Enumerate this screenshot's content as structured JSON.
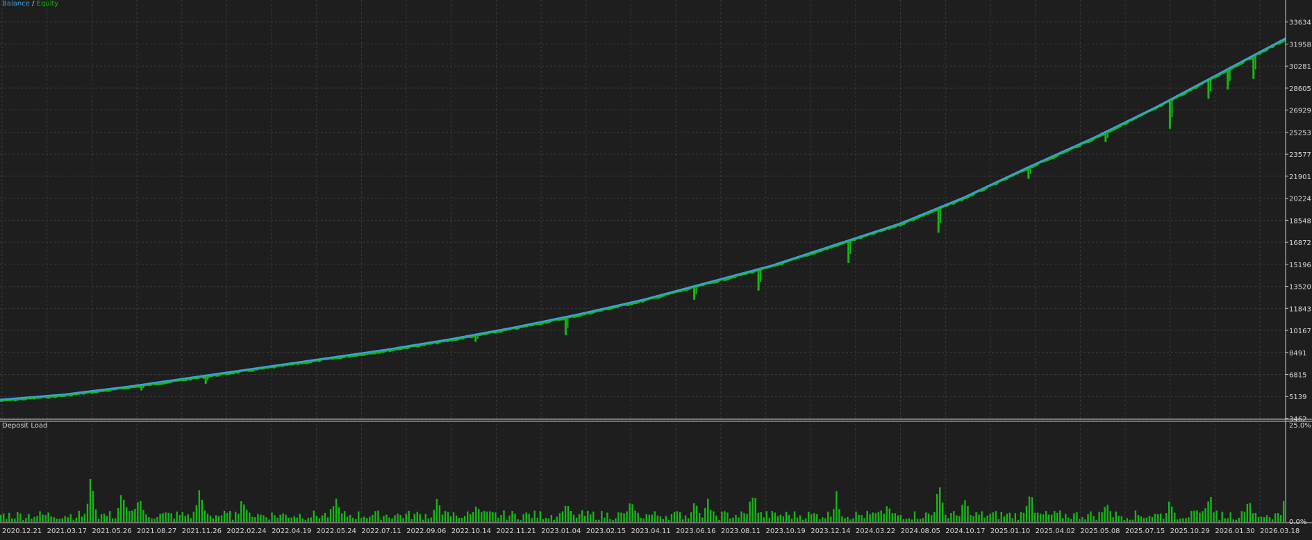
{
  "legend": {
    "balance_label": "Balance",
    "separator": "/",
    "equity_label": "Equity"
  },
  "colors": {
    "background": "#1e1e1e",
    "grid": "#3a3a3a",
    "axis": "#cfcfcf",
    "balance": "#3b9fe0",
    "equity": "#14b814",
    "deposit_load": "#14b814",
    "text": "#d8d8d8"
  },
  "chart_data": [
    {
      "type": "line",
      "name": "balance-equity-chart",
      "yticks": [
        3462,
        5139,
        6815,
        8491,
        10167,
        11843,
        13520,
        15196,
        16872,
        18548,
        20224,
        21901,
        23577,
        25253,
        26929,
        28605,
        30281,
        31958,
        33634
      ],
      "ylim": [
        3462,
        35310
      ],
      "xlim": [
        0,
        1
      ],
      "grid": true,
      "series": [
        {
          "name": "Balance",
          "color": "#3b9fe0",
          "x": [
            0.0,
            0.05,
            0.1,
            0.15,
            0.2,
            0.25,
            0.3,
            0.35,
            0.4,
            0.45,
            0.5,
            0.55,
            0.6,
            0.65,
            0.7,
            0.75,
            0.8,
            0.85,
            0.9,
            0.95,
            1.0
          ],
          "values": [
            4900,
            5300,
            5900,
            6600,
            7300,
            8000,
            8700,
            9500,
            10400,
            11400,
            12500,
            13800,
            15100,
            16700,
            18300,
            20300,
            22600,
            24800,
            27200,
            29800,
            32400
          ]
        },
        {
          "name": "Equity",
          "color": "#14b814",
          "dips": [
            {
              "x": 0.11,
              "low": 5600
            },
            {
              "x": 0.16,
              "low": 6100
            },
            {
              "x": 0.37,
              "low": 9300
            },
            {
              "x": 0.44,
              "low": 9800
            },
            {
              "x": 0.54,
              "low": 12500
            },
            {
              "x": 0.59,
              "low": 13200
            },
            {
              "x": 0.66,
              "low": 15300
            },
            {
              "x": 0.73,
              "low": 17600
            },
            {
              "x": 0.8,
              "low": 21700
            },
            {
              "x": 0.86,
              "low": 24500
            },
            {
              "x": 0.91,
              "low": 25500
            },
            {
              "x": 0.94,
              "low": 27800
            },
            {
              "x": 0.955,
              "low": 28500
            },
            {
              "x": 0.975,
              "low": 29300
            }
          ]
        }
      ]
    },
    {
      "type": "bar",
      "name": "deposit-load-chart",
      "title": "Deposit Load",
      "yticks": [
        "25.0%",
        "0.0%"
      ],
      "ylim": [
        0,
        25
      ],
      "peaks": [
        {
          "x": 0.07,
          "value": 12
        },
        {
          "x": 0.095,
          "value": 10
        },
        {
          "x": 0.107,
          "value": 9
        },
        {
          "x": 0.155,
          "value": 10
        },
        {
          "x": 0.188,
          "value": 7
        },
        {
          "x": 0.26,
          "value": 8
        },
        {
          "x": 0.34,
          "value": 7
        },
        {
          "x": 0.37,
          "value": 6
        },
        {
          "x": 0.44,
          "value": 7
        },
        {
          "x": 0.49,
          "value": 6
        },
        {
          "x": 0.54,
          "value": 8
        },
        {
          "x": 0.55,
          "value": 6
        },
        {
          "x": 0.585,
          "value": 10
        },
        {
          "x": 0.65,
          "value": 8
        },
        {
          "x": 0.69,
          "value": 6
        },
        {
          "x": 0.73,
          "value": 11
        },
        {
          "x": 0.75,
          "value": 7
        },
        {
          "x": 0.8,
          "value": 10
        },
        {
          "x": 0.86,
          "value": 7
        },
        {
          "x": 0.91,
          "value": 7
        },
        {
          "x": 0.94,
          "value": 9
        },
        {
          "x": 0.97,
          "value": 7
        },
        {
          "x": 1.0,
          "value": 9
        }
      ],
      "xticks": [
        "2020.12.21",
        "2021.03.17",
        "2021.05.26",
        "2021.08.27",
        "2021.11.26",
        "2022.02.24",
        "2022.04.19",
        "2022.05.24",
        "2022.07.11",
        "2022.09.06",
        "2022.10.14",
        "2022.11.21",
        "2023.01.04",
        "2023.02.15",
        "2023.04.11",
        "2023.06.16",
        "2023.08.11",
        "2023.10.19",
        "2023.12.14",
        "2024.03.22",
        "2024.08.05",
        "2024.10.17",
        "2025.01.10",
        "2025.04.02",
        "2025.05.08",
        "2025.07.15",
        "2025.10.29",
        "2026.01.30",
        "2026.03.18"
      ]
    }
  ]
}
